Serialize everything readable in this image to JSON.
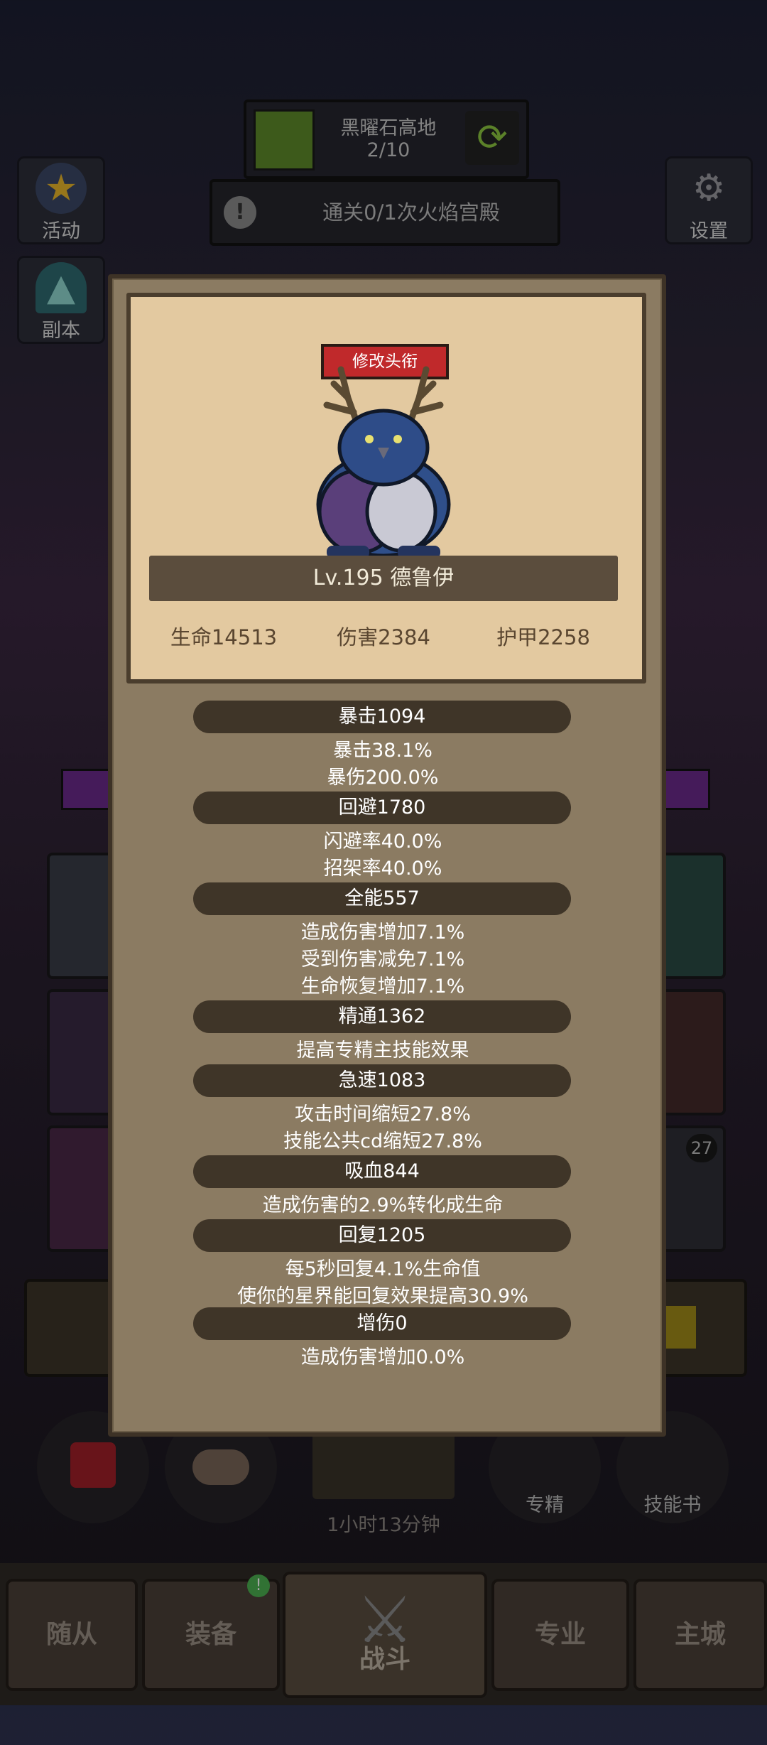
{
  "hud": {
    "stage_name": "黑曜石高地",
    "stage_progress": "2/10",
    "quest_text": "通关0/1次火焰宫殿",
    "left_buttons": [
      {
        "label": "活动",
        "icon": "star-icon"
      },
      {
        "label": "副本",
        "icon": "dungeon-door-icon"
      }
    ],
    "settings_label": "设置"
  },
  "background": {
    "timer_text": "1小时13分钟",
    "slot_badge": "27",
    "bottom_labels": {
      "specialty": "专精",
      "skill_book": "技能书"
    },
    "nav": [
      "随从",
      "装备",
      "战斗",
      "专业",
      "主城"
    ],
    "nav_notice": "!"
  },
  "hero": {
    "edit_title_label": "修改头衔",
    "name_line": "Lv.195 德鲁伊",
    "stats": [
      {
        "label": "生命14513"
      },
      {
        "label": "伤害2384"
      },
      {
        "label": "护甲2258"
      }
    ]
  },
  "details": [
    {
      "header": "暴击1094",
      "lines": [
        "暴击38.1%",
        "暴伤200.0%"
      ]
    },
    {
      "header": "回避1780",
      "lines": [
        "闪避率40.0%",
        "招架率40.0%"
      ]
    },
    {
      "header": "全能557",
      "lines": [
        "造成伤害增加7.1%",
        "受到伤害减免7.1%",
        "生命恢复增加7.1%"
      ]
    },
    {
      "header": "精通1362",
      "lines": [
        "提高专精主技能效果"
      ]
    },
    {
      "header": "急速1083",
      "lines": [
        "攻击时间缩短27.8%",
        "技能公共cd缩短27.8%"
      ]
    },
    {
      "header": "吸血844",
      "lines": [
        "造成伤害的2.9%转化成生命"
      ]
    },
    {
      "header": "回复1205",
      "lines": [
        "每5秒回复4.1%生命值",
        "使你的星界能回复效果提高30.9%"
      ]
    },
    {
      "header": "增伤0",
      "lines": [
        "造成伤害增加0.0%"
      ]
    }
  ],
  "colors": {
    "modal_bg": "#8b7b62",
    "card_bg": "#e3c9a0",
    "pill_bg": "#3f3528",
    "title_button": "#c0292b",
    "stage_green": "#5e8a2a"
  }
}
